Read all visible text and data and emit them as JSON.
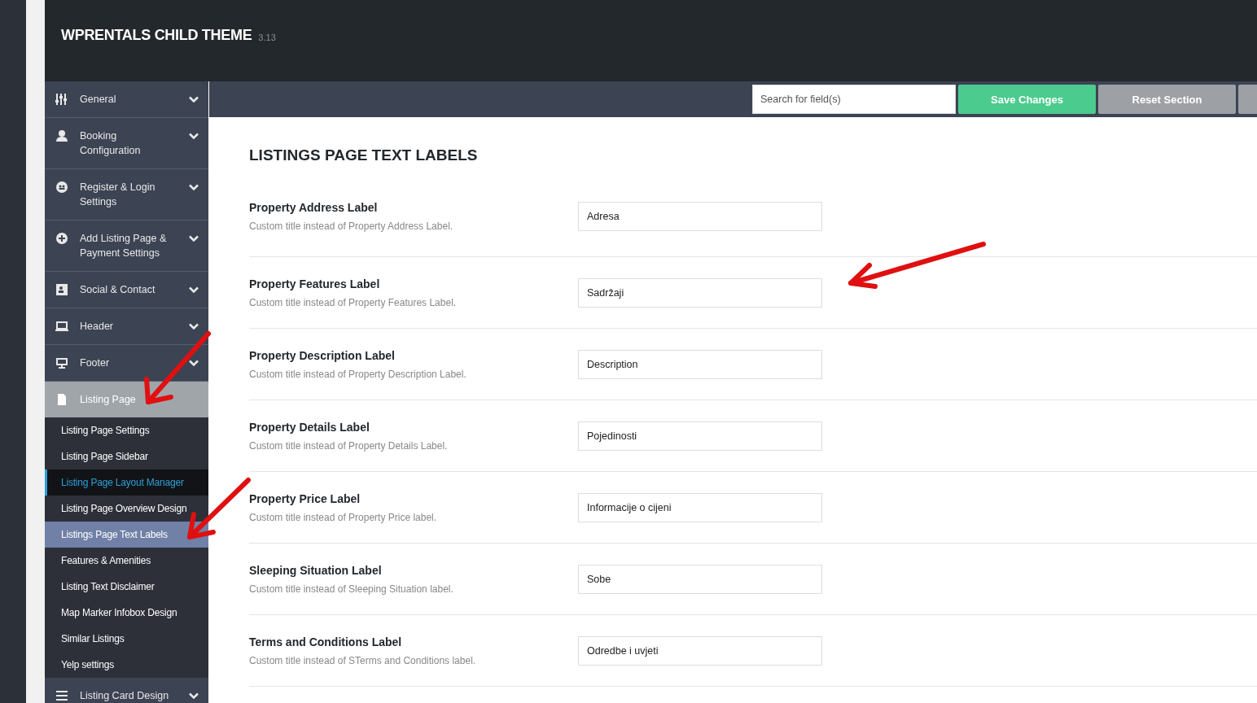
{
  "header": {
    "title": "WPRENTALS CHILD THEME",
    "version": "3.13"
  },
  "sidebar": {
    "items": [
      {
        "label": "General",
        "expanded": false,
        "selected": false
      },
      {
        "label": "Booking Configuration",
        "expanded": false,
        "selected": false
      },
      {
        "label": "Register & Login Settings",
        "expanded": false,
        "selected": false
      },
      {
        "label": "Add Listing Page & Payment Settings",
        "expanded": false,
        "selected": false
      },
      {
        "label": "Social & Contact",
        "expanded": false,
        "selected": false
      },
      {
        "label": "Header",
        "expanded": false,
        "selected": false
      },
      {
        "label": "Footer",
        "expanded": false,
        "selected": false
      },
      {
        "label": "Listing Page",
        "expanded": true,
        "selected": true,
        "children": [
          {
            "label": "Listing Page Settings",
            "selected": false,
            "hovered": false
          },
          {
            "label": "Listing Page Sidebar",
            "selected": false,
            "hovered": false
          },
          {
            "label": "Listing Page Layout Manager",
            "selected": false,
            "hovered": true
          },
          {
            "label": "Listing Page Overview Design",
            "selected": false,
            "hovered": false
          },
          {
            "label": "Listings Page Text Labels",
            "selected": true,
            "hovered": false
          },
          {
            "label": "Features & Amenities",
            "selected": false,
            "hovered": false
          },
          {
            "label": "Listing Text Disclaimer",
            "selected": false,
            "hovered": false
          },
          {
            "label": "Map Marker Infobox Design",
            "selected": false,
            "hovered": false
          },
          {
            "label": "Similar Listings",
            "selected": false,
            "hovered": false
          },
          {
            "label": "Yelp settings",
            "selected": false,
            "hovered": false
          }
        ]
      },
      {
        "label": "Listing Card Design",
        "expanded": false,
        "selected": false
      }
    ]
  },
  "toolbar": {
    "search": {
      "placeholder": "Search for field(s)"
    },
    "buttons": [
      {
        "label": "Save Changes",
        "kind": "primary"
      },
      {
        "label": "Reset Section",
        "kind": "secondary"
      }
    ]
  },
  "section": {
    "title": "LISTINGS PAGE TEXT LABELS",
    "fields": [
      {
        "label": "Property Address Label",
        "description": "Custom title instead of Property Address Label.",
        "value": "Adresa"
      },
      {
        "label": "Property Features Label",
        "description": "Custom title instead of Property Features Label.",
        "value": "Sadržaji"
      },
      {
        "label": "Property Description Label",
        "description": "Custom title instead of Property Description Label.",
        "value": "Description"
      },
      {
        "label": "Property Details Label",
        "description": "Custom title instead of Property Details Label.",
        "value": "Pojedinosti"
      },
      {
        "label": "Property Price Label",
        "description": "Custom title instead of Property Price label.",
        "value": "Informacije o cijeni"
      },
      {
        "label": "Sleeping Situation Label",
        "description": "Custom title instead of Sleeping Situation label.",
        "value": "Sobe"
      },
      {
        "label": "Terms and Conditions Label",
        "description": "Custom title instead of STerms and Conditions label.",
        "value": "Odredbe i uvjeti"
      }
    ]
  }
}
